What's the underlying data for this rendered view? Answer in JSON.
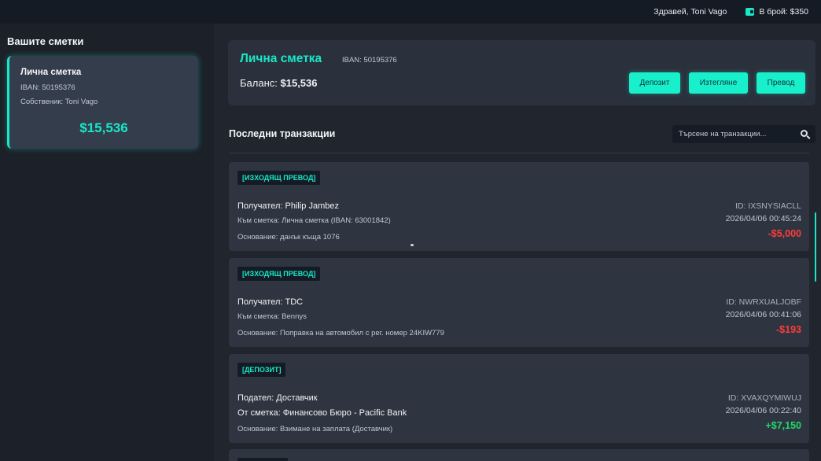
{
  "topbar": {
    "greeting": "Здравей, Toni Vago",
    "cash": "В брой: $350"
  },
  "sidebar": {
    "title": "Вашите сметки",
    "accounts": [
      {
        "name": "Лична сметка",
        "iban": "IBAN: 50195376",
        "owner": "Собственик: Toni Vago",
        "balance": "$15,536"
      }
    ]
  },
  "header": {
    "title": "Лична сметка",
    "iban": "IBAN: 50195376",
    "balance_label": "Баланс:",
    "balance_value": "$15,536",
    "buttons": {
      "deposit": "Депозит",
      "withdraw": "Изтегляне",
      "transfer": "Превод"
    }
  },
  "transactions": {
    "title": "Последни транзакции",
    "search_placeholder": "Търсене на транзакции...",
    "items": [
      {
        "type": "[ИЗХОДЯЩ ПРЕВОД]",
        "party": "Получател: Philip Jambez",
        "account": "Към сметка: Лична сметка (IBAN: 63001842)",
        "reason": "Основание: данък къща 1076",
        "id": "ID: IXSNYSIACLL",
        "date": "2026/04/06 00:45:24",
        "amount": "-$5,000",
        "direction": "neg"
      },
      {
        "type": "[ИЗХОДЯЩ ПРЕВОД]",
        "party": "Получател: TDC",
        "account": "Към сметка: Bennys",
        "reason": "Основание: Поправка на автомобил с рег. номер 24KIW779",
        "id": "ID: NWRXUALJOBF",
        "date": "2026/04/06 00:41:06",
        "amount": "-$193",
        "direction": "neg"
      },
      {
        "type": "[ДЕПОЗИТ]",
        "party": "Подател: Доставчик",
        "account": "От сметка: Финансово Бюро - Pacific Bank",
        "reason": "Основание: Взимане на заплата (Доставчик)",
        "id": "ID: XVAXQYMIWUJ",
        "date": "2026/04/06 00:22:40",
        "amount": "+$7,150",
        "direction": "pos"
      }
    ]
  },
  "colors": {
    "accent": "#18e8c8",
    "negative": "#ff3b3b",
    "positive": "#22d96b"
  }
}
